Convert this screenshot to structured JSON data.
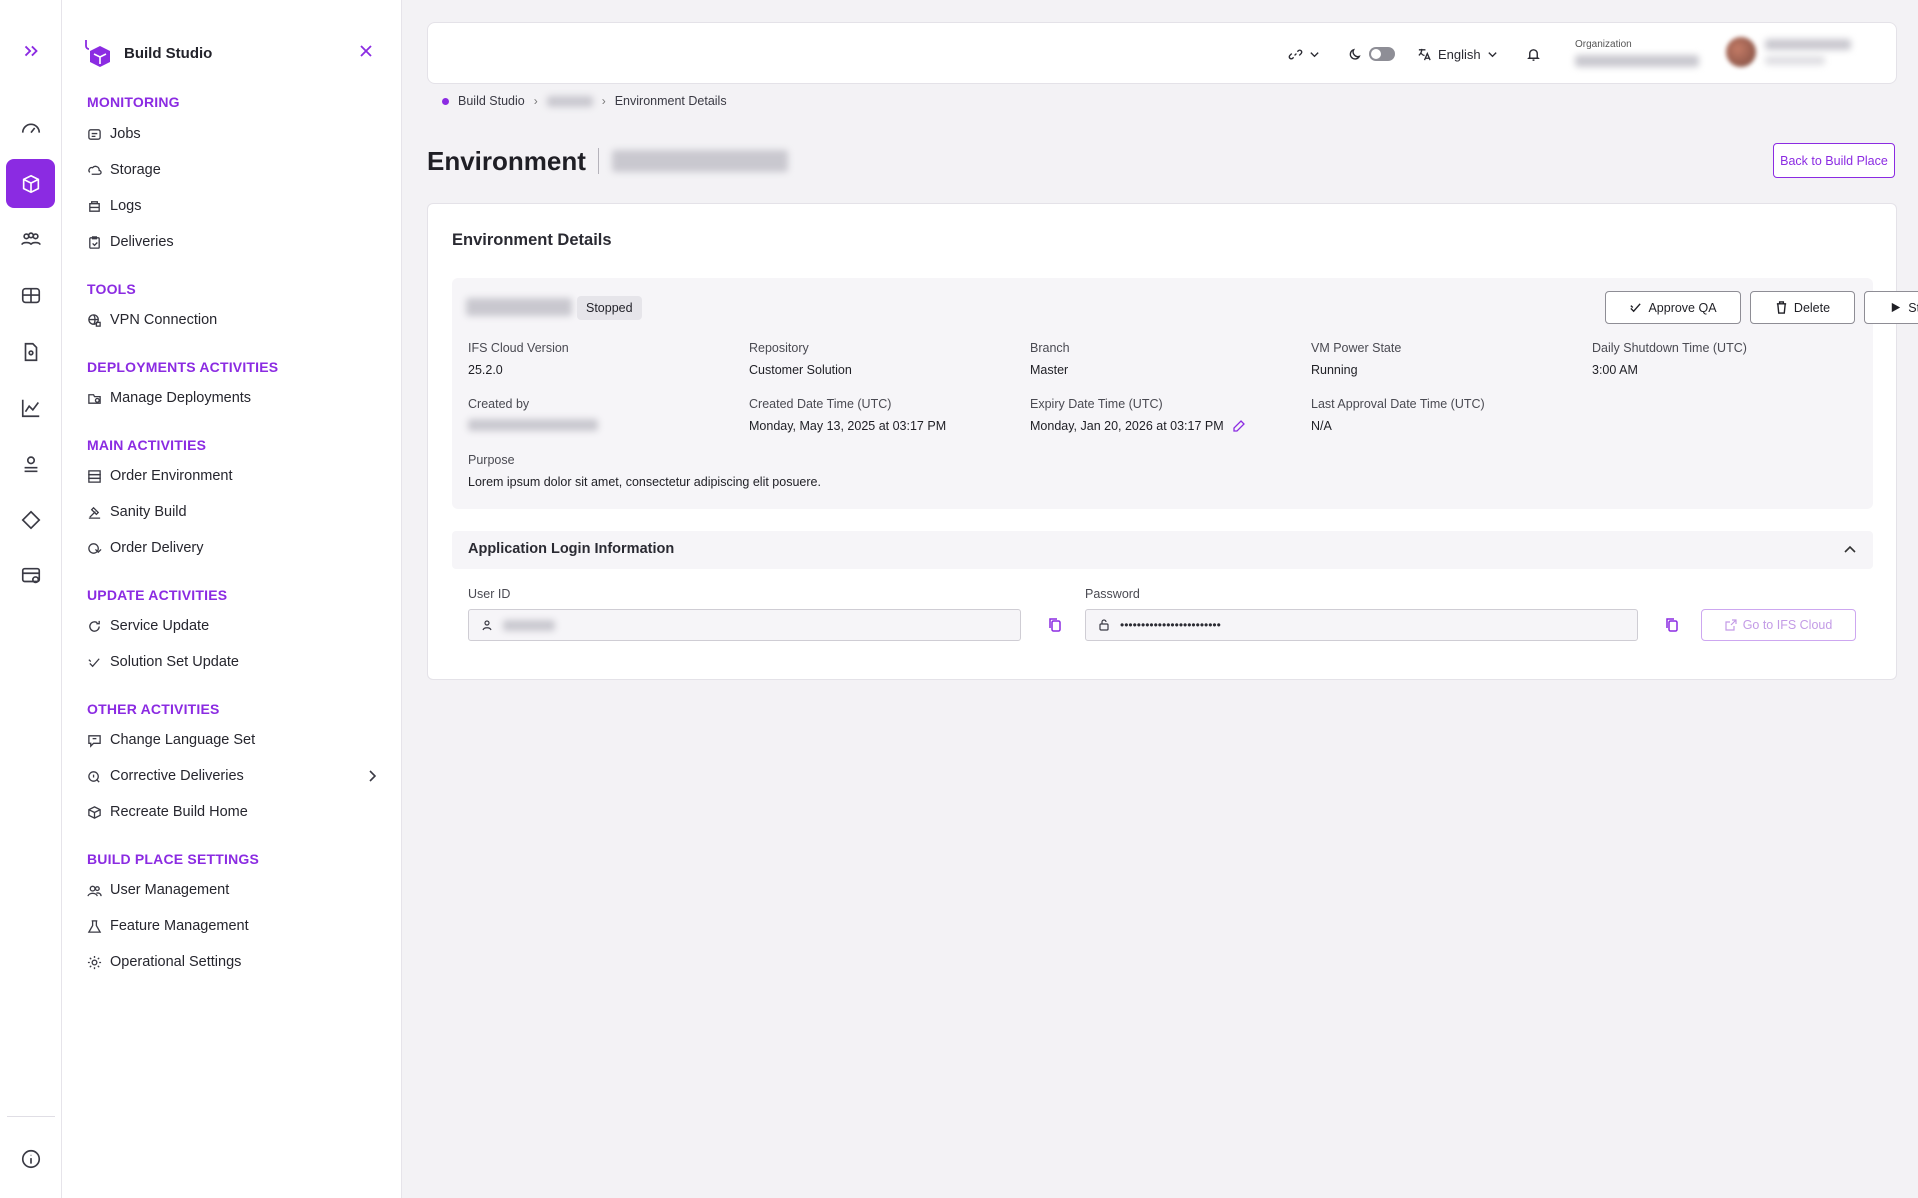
{
  "app": {
    "name": "Build Studio"
  },
  "sidebar": {
    "sections": {
      "monitoring": "MONITORING",
      "tools": "TOOLS",
      "deployments": "DEPLOYMENTS ACTIVITIES",
      "main": "MAIN ACTIVITIES",
      "update": "UPDATE ACTIVITIES",
      "other": "OTHER ACTIVITIES",
      "settings": "BUILD PLACE SETTINGS"
    },
    "items": {
      "jobs": "Jobs",
      "storage": "Storage",
      "logs": "Logs",
      "deliveries": "Deliveries",
      "vpn": "VPN Connection",
      "manage_deployments": "Manage Deployments",
      "order_environment": "Order Environment",
      "sanity_build": "Sanity Build",
      "order_delivery": "Order Delivery",
      "service_update": "Service Update",
      "solution_set_update": "Solution Set Update",
      "change_language_set": "Change Language Set",
      "corrective_deliveries": "Corrective Deliveries",
      "recreate_build_home": "Recreate Build Home",
      "user_management": "User Management",
      "feature_management": "Feature Management",
      "operational_settings": "Operational Settings"
    }
  },
  "topbar": {
    "language": "English",
    "organization_label": "Organization"
  },
  "breadcrumb": {
    "root": "Build Studio",
    "current": "Environment Details"
  },
  "page": {
    "title": "Environment",
    "back_button": "Back to Build Place"
  },
  "details": {
    "title": "Environment Details",
    "status": "Stopped",
    "actions": {
      "approve": "Approve QA",
      "delete": "Delete",
      "start": "Start"
    },
    "fields": {
      "ifs_version": {
        "label": "IFS Cloud Version",
        "value": "25.2.0"
      },
      "repository": {
        "label": "Repository",
        "value": "Customer Solution"
      },
      "branch": {
        "label": "Branch",
        "value": "Master"
      },
      "vm_power": {
        "label": "VM Power State",
        "value": "Running"
      },
      "daily_shutdown": {
        "label": "Daily Shutdown Time (UTC)",
        "value": "3:00 AM"
      },
      "created_by": {
        "label": "Created by"
      },
      "created_date": {
        "label": "Created Date Time (UTC)",
        "value": "Monday, May 13, 2025 at 03:17 PM"
      },
      "expiry_date": {
        "label": "Expiry Date Time (UTC)",
        "value": "Monday, Jan 20, 2026 at 03:17 PM"
      },
      "last_approval": {
        "label": "Last Approval Date Time (UTC)",
        "value": "N/A"
      },
      "purpose": {
        "label": "Purpose",
        "value": "Lorem ipsum dolor sit amet, consectetur adipiscing elit posuere."
      }
    }
  },
  "login": {
    "title": "Application Login Information",
    "user_id_label": "User ID",
    "password_label": "Password",
    "password_value": "••••••••••••••••••••••••",
    "goto_button": "Go to IFS Cloud"
  },
  "colors": {
    "accent": "#8b2be2",
    "background": "#f3f2f5"
  }
}
